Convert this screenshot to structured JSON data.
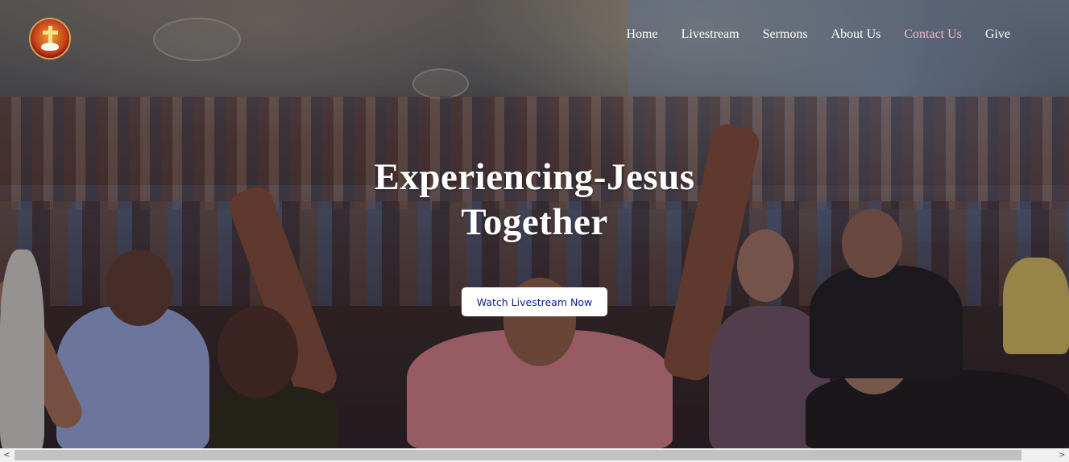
{
  "header": {
    "logo_icon": "church-cross-dove-logo-icon",
    "nav": [
      {
        "label": "Home",
        "active": false
      },
      {
        "label": "Livestream",
        "active": false
      },
      {
        "label": "Sermons",
        "active": false
      },
      {
        "label": "About Us",
        "active": false
      },
      {
        "label": "Contact Us",
        "active": true
      },
      {
        "label": "Give",
        "active": false
      }
    ]
  },
  "hero": {
    "title_line1": "Experiencing-Jesus",
    "title_line2": "Together",
    "cta_label": "Watch Livestream Now",
    "background": "worship-crowd-photo"
  },
  "scrollbar": {
    "left_icon": "chevron-left-icon",
    "right_icon": "chevron-right-icon",
    "left_glyph": "<",
    "right_glyph": ">"
  },
  "colors": {
    "nav_text": "#ffffff",
    "nav_active": "#f4b6cf",
    "cta_text": "#10208a",
    "cta_bg": "#ffffff"
  }
}
